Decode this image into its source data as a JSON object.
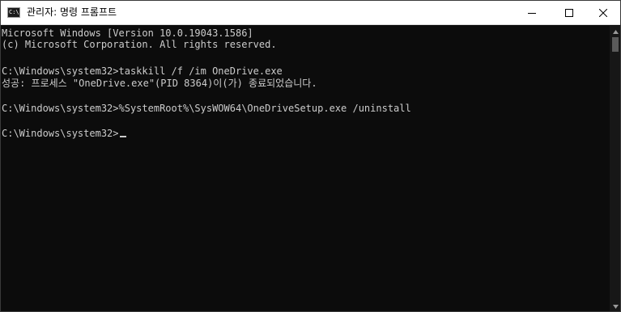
{
  "window": {
    "title": "관리자: 명령 프롬프트",
    "icon": "cmd-icon",
    "icon_text": "C:\\"
  },
  "controls": {
    "minimize_icon": "minimize-icon",
    "maximize_icon": "maximize-icon",
    "close_icon": "close-icon"
  },
  "terminal": {
    "lines": [
      "Microsoft Windows [Version 10.0.19043.1586]",
      "(c) Microsoft Corporation. All rights reserved.",
      "",
      "C:\\Windows\\system32>taskkill /f /im OneDrive.exe",
      "성공: 프로세스 \"OneDrive.exe\"(PID 8364)이(가) 종료되었습니다.",
      "",
      "C:\\Windows\\system32>%SystemRoot%\\SysWOW64\\OneDriveSetup.exe /uninstall",
      "",
      "C:\\Windows\\system32>"
    ]
  },
  "colors": {
    "terminal_background": "#0c0c0c",
    "terminal_text": "#cccccc",
    "titlebar_background": "#ffffff"
  }
}
